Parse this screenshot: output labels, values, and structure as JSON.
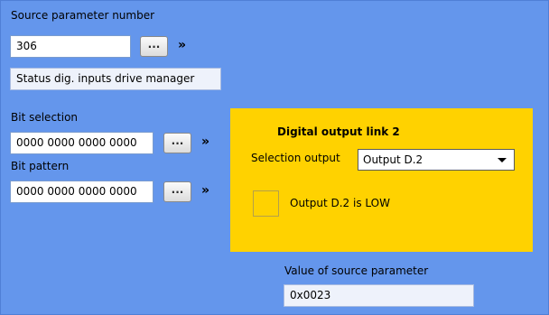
{
  "source": {
    "label": "Source parameter number",
    "value": "306",
    "browse_label": "...",
    "goto_label": "»",
    "description": "Status dig. inputs drive manager"
  },
  "bit_selection": {
    "label": "Bit selection",
    "value": "0000 0000 0000 0000",
    "browse_label": "...",
    "goto_label": "»"
  },
  "bit_pattern": {
    "label": "Bit pattern",
    "value": "0000 0000 0000 0000",
    "browse_label": "...",
    "goto_label": "»"
  },
  "output_link": {
    "title": "Digital output link 2",
    "selection_label": "Selection output",
    "selection_value": "Output D.2",
    "status_text": "Output D.2 is LOW"
  },
  "source_value": {
    "label": "Value of source parameter",
    "value": "0x0023"
  },
  "colors": {
    "panel_bg": "#6496ec",
    "highlight_box": "#ffd200"
  }
}
